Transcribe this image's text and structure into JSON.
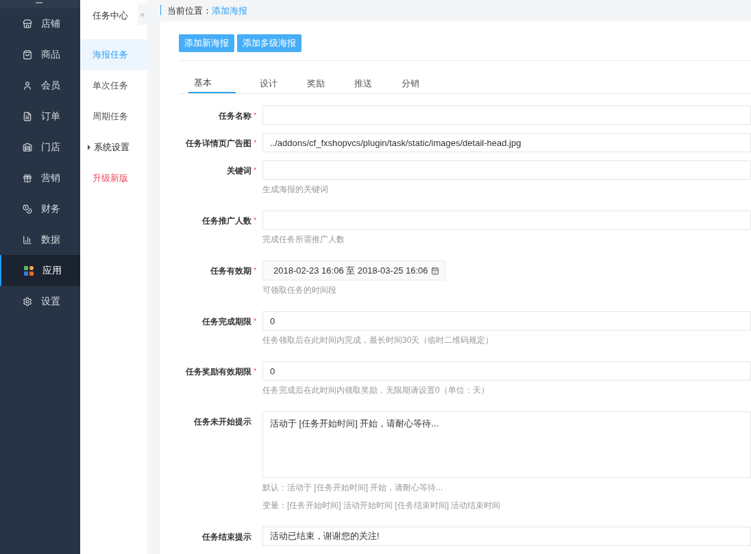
{
  "main_nav": [
    {
      "label": "店铺",
      "selected": false
    },
    {
      "label": "商品",
      "selected": false
    },
    {
      "label": "会员",
      "selected": false
    },
    {
      "label": "订单",
      "selected": false
    },
    {
      "label": "门店",
      "selected": false
    },
    {
      "label": "营销",
      "selected": false
    },
    {
      "label": "财务",
      "selected": false
    },
    {
      "label": "数据",
      "selected": false
    },
    {
      "label": "应用",
      "selected": true
    },
    {
      "label": "设置",
      "selected": false
    }
  ],
  "sub_nav": {
    "title": "任务中心",
    "collapse": "«",
    "items": [
      {
        "label": "海报任务",
        "kind": "item",
        "selected": true
      },
      {
        "label": "单次任务",
        "kind": "item",
        "selected": false
      },
      {
        "label": "周期任务",
        "kind": "item",
        "selected": false
      },
      {
        "label": "系统设置",
        "kind": "group",
        "selected": false
      },
      {
        "label": "升级新版",
        "kind": "upgrade",
        "selected": false
      }
    ]
  },
  "breadcrumb": {
    "label": "当前位置：",
    "current": "添加海报"
  },
  "buttons": [
    "添加新海报",
    "添加多级海报"
  ],
  "tabs": [
    {
      "label": "基本",
      "selected": true
    },
    {
      "label": "设计",
      "selected": false
    },
    {
      "label": "奖励",
      "selected": false
    },
    {
      "label": "推送",
      "selected": false
    },
    {
      "label": "分销",
      "selected": false
    }
  ],
  "form": [
    {
      "label": "任务名称",
      "required_mark": "*",
      "kind": "text"
    },
    {
      "label": "任务详情页广告图",
      "required_mark": "*",
      "kind": "text",
      "value": "../addons/cf_fxshopvcs/plugin/task/static/images/detail-head.jpg"
    },
    {
      "label": "关键词",
      "required_mark": "*",
      "kind": "text",
      "hints": [
        "生成海报的关键词"
      ]
    },
    {
      "label": "任务推广人数",
      "required_mark": "*",
      "kind": "text",
      "hints": [
        "完成任务所需推广人数"
      ]
    },
    {
      "label": "任务有效期",
      "required_mark": "*",
      "kind": "date",
      "value": "2018-02-23 16:06 至 2018-03-25 16:06",
      "hints": [
        "可领取任务的时间段"
      ]
    },
    {
      "label": "任务完成期限",
      "required_mark": "*",
      "kind": "text",
      "value": "0",
      "hints": [
        "任务领取后在此时间内完成，最长时间30天（临时二维码规定）"
      ]
    },
    {
      "label": "任务奖励有效期限",
      "required_mark": "*",
      "kind": "text",
      "value": "0",
      "hints": [
        "任务完成后在此时间内领取奖励，无限期请设置0（单位：天）"
      ]
    },
    {
      "label": "任务未开始提示",
      "kind": "textarea",
      "value": "活动于 [任务开始时间] 开始，请耐心等待...",
      "hints": [
        "默认：活动于 [任务开始时间] 开始，请耐心等待...",
        "变量：[任务开始时间] 活动开始时间 [任务结束时间] 活动结束时间"
      ]
    },
    {
      "label": "任务结束提示",
      "kind": "text",
      "value": "活动已结束，谢谢您的关注!"
    }
  ]
}
